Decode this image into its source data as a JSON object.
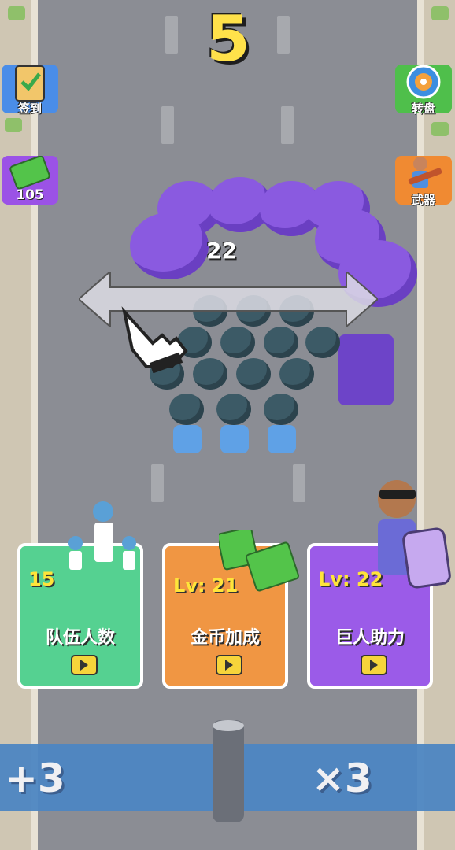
{
  "hud": {
    "score": "5",
    "crowd_count": "22"
  },
  "side_buttons": {
    "checkin_label": "签到",
    "cash_amount": "105",
    "wheel_label": "转盘",
    "weapon_label": "武器"
  },
  "upgrades": [
    {
      "title": "队伍人数",
      "value": "15"
    },
    {
      "title": "金币加成",
      "value": "Lv: 21"
    },
    {
      "title": "巨人助力",
      "value": "Lv: 22"
    }
  ],
  "gate": {
    "left_label": "+3",
    "right_label": "×3"
  },
  "colors": {
    "score": "#ffe14a",
    "gate": "#4d86c2",
    "card_green": "#55d191",
    "card_orange": "#f09643",
    "card_purple": "#9b5be8"
  }
}
